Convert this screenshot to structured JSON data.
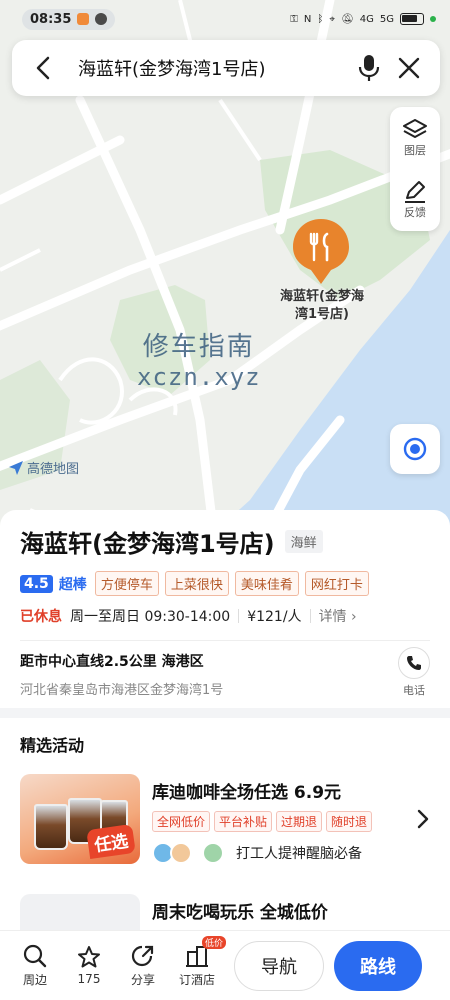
{
  "status_bar": {
    "time": "08:35",
    "signal_1": "4G",
    "signal_2": "5G"
  },
  "search": {
    "title": "海蓝轩(金梦海湾1号店)"
  },
  "map": {
    "tools": [
      {
        "label": "图层",
        "icon": "layers-icon"
      },
      {
        "label": "反馈",
        "icon": "edit-icon"
      }
    ],
    "pin_label": [
      "海蓝轩(金梦海",
      "湾1号店)"
    ],
    "watermark_cn": "修车指南",
    "watermark_en": "xczn.xyz",
    "logo_text": "高德地图"
  },
  "poi": {
    "name": "海蓝轩(金梦海湾1号店)",
    "category": "海鲜",
    "rating": "4.5",
    "rating_text": "超棒",
    "tags": [
      "方便停车",
      "上菜很快",
      "美味佳肴",
      "网红打卡"
    ],
    "status": "已休息",
    "hours": "周一至周日 09:30-14:00",
    "price": "¥121/人",
    "detail_label": "详情",
    "distance": "距市中心直线2.5公里 海港区",
    "address": "河北省秦皇岛市海港区金梦海湾1号",
    "phone_label": "电话"
  },
  "activities": {
    "title": "精选活动",
    "items": [
      {
        "title": "库迪咖啡全场任选 6.9元",
        "badge": "任选",
        "tags": [
          "全网低价",
          "平台补贴",
          "过期退",
          "随时退"
        ],
        "footer": "打工人提神醒脑必备"
      },
      {
        "title": "周末吃喝玩乐 全城低价",
        "tags": [],
        "footer": ""
      }
    ]
  },
  "bottom_bar": {
    "items": [
      {
        "label": "周边",
        "icon": "search-icon"
      },
      {
        "label": "175",
        "icon": "star-icon"
      },
      {
        "label": "分享",
        "icon": "share-icon"
      },
      {
        "label": "订酒店",
        "icon": "hotel-icon",
        "badge": "低价"
      }
    ],
    "nav_label": "导航",
    "route_label": "路线"
  },
  "colors": {
    "accent": "#2a6bf0",
    "closed": "#e0402a",
    "pin": "#e8842c",
    "water": "#c9dff5",
    "green": "#d8e8d2"
  }
}
